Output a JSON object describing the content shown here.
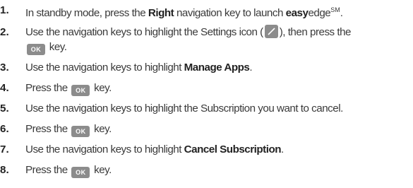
{
  "steps": [
    {
      "num": "1.",
      "pre": "In standby mode, press the ",
      "bold": "Right",
      "mid": " navigation key to launch ",
      "brand_bold": "easy",
      "brand": "edge",
      "sup": "SM",
      "post": "."
    },
    {
      "num": "2.",
      "pre": "Use the navigation keys to highlight the Settings icon (",
      "post1": "), then press the",
      "key": "OK",
      "post2": " key."
    },
    {
      "num": "3.",
      "pre": "Use the navigation keys to highlight ",
      "bold": "Manage Apps",
      "post": "."
    },
    {
      "num": "4.",
      "pre": "Press the ",
      "key": "OK",
      "post": " key."
    },
    {
      "num": "5.",
      "pre": "Use the navigation keys to highlight the Subscription you want to cancel."
    },
    {
      "num": "6.",
      "pre": "Press the ",
      "key": "OK",
      "post": " key."
    },
    {
      "num": "7.",
      "pre": "Use the navigation keys to highlight ",
      "bold": "Cancel Subscription",
      "post": "."
    },
    {
      "num": "8.",
      "pre": "Press the ",
      "key": "OK",
      "post": " key."
    }
  ],
  "icons": {
    "settings": "settings-slash-icon",
    "ok_key": "ok-key-icon"
  },
  "colors": {
    "text": "#3a3a3a",
    "key_bg": "#8c8c8c"
  }
}
